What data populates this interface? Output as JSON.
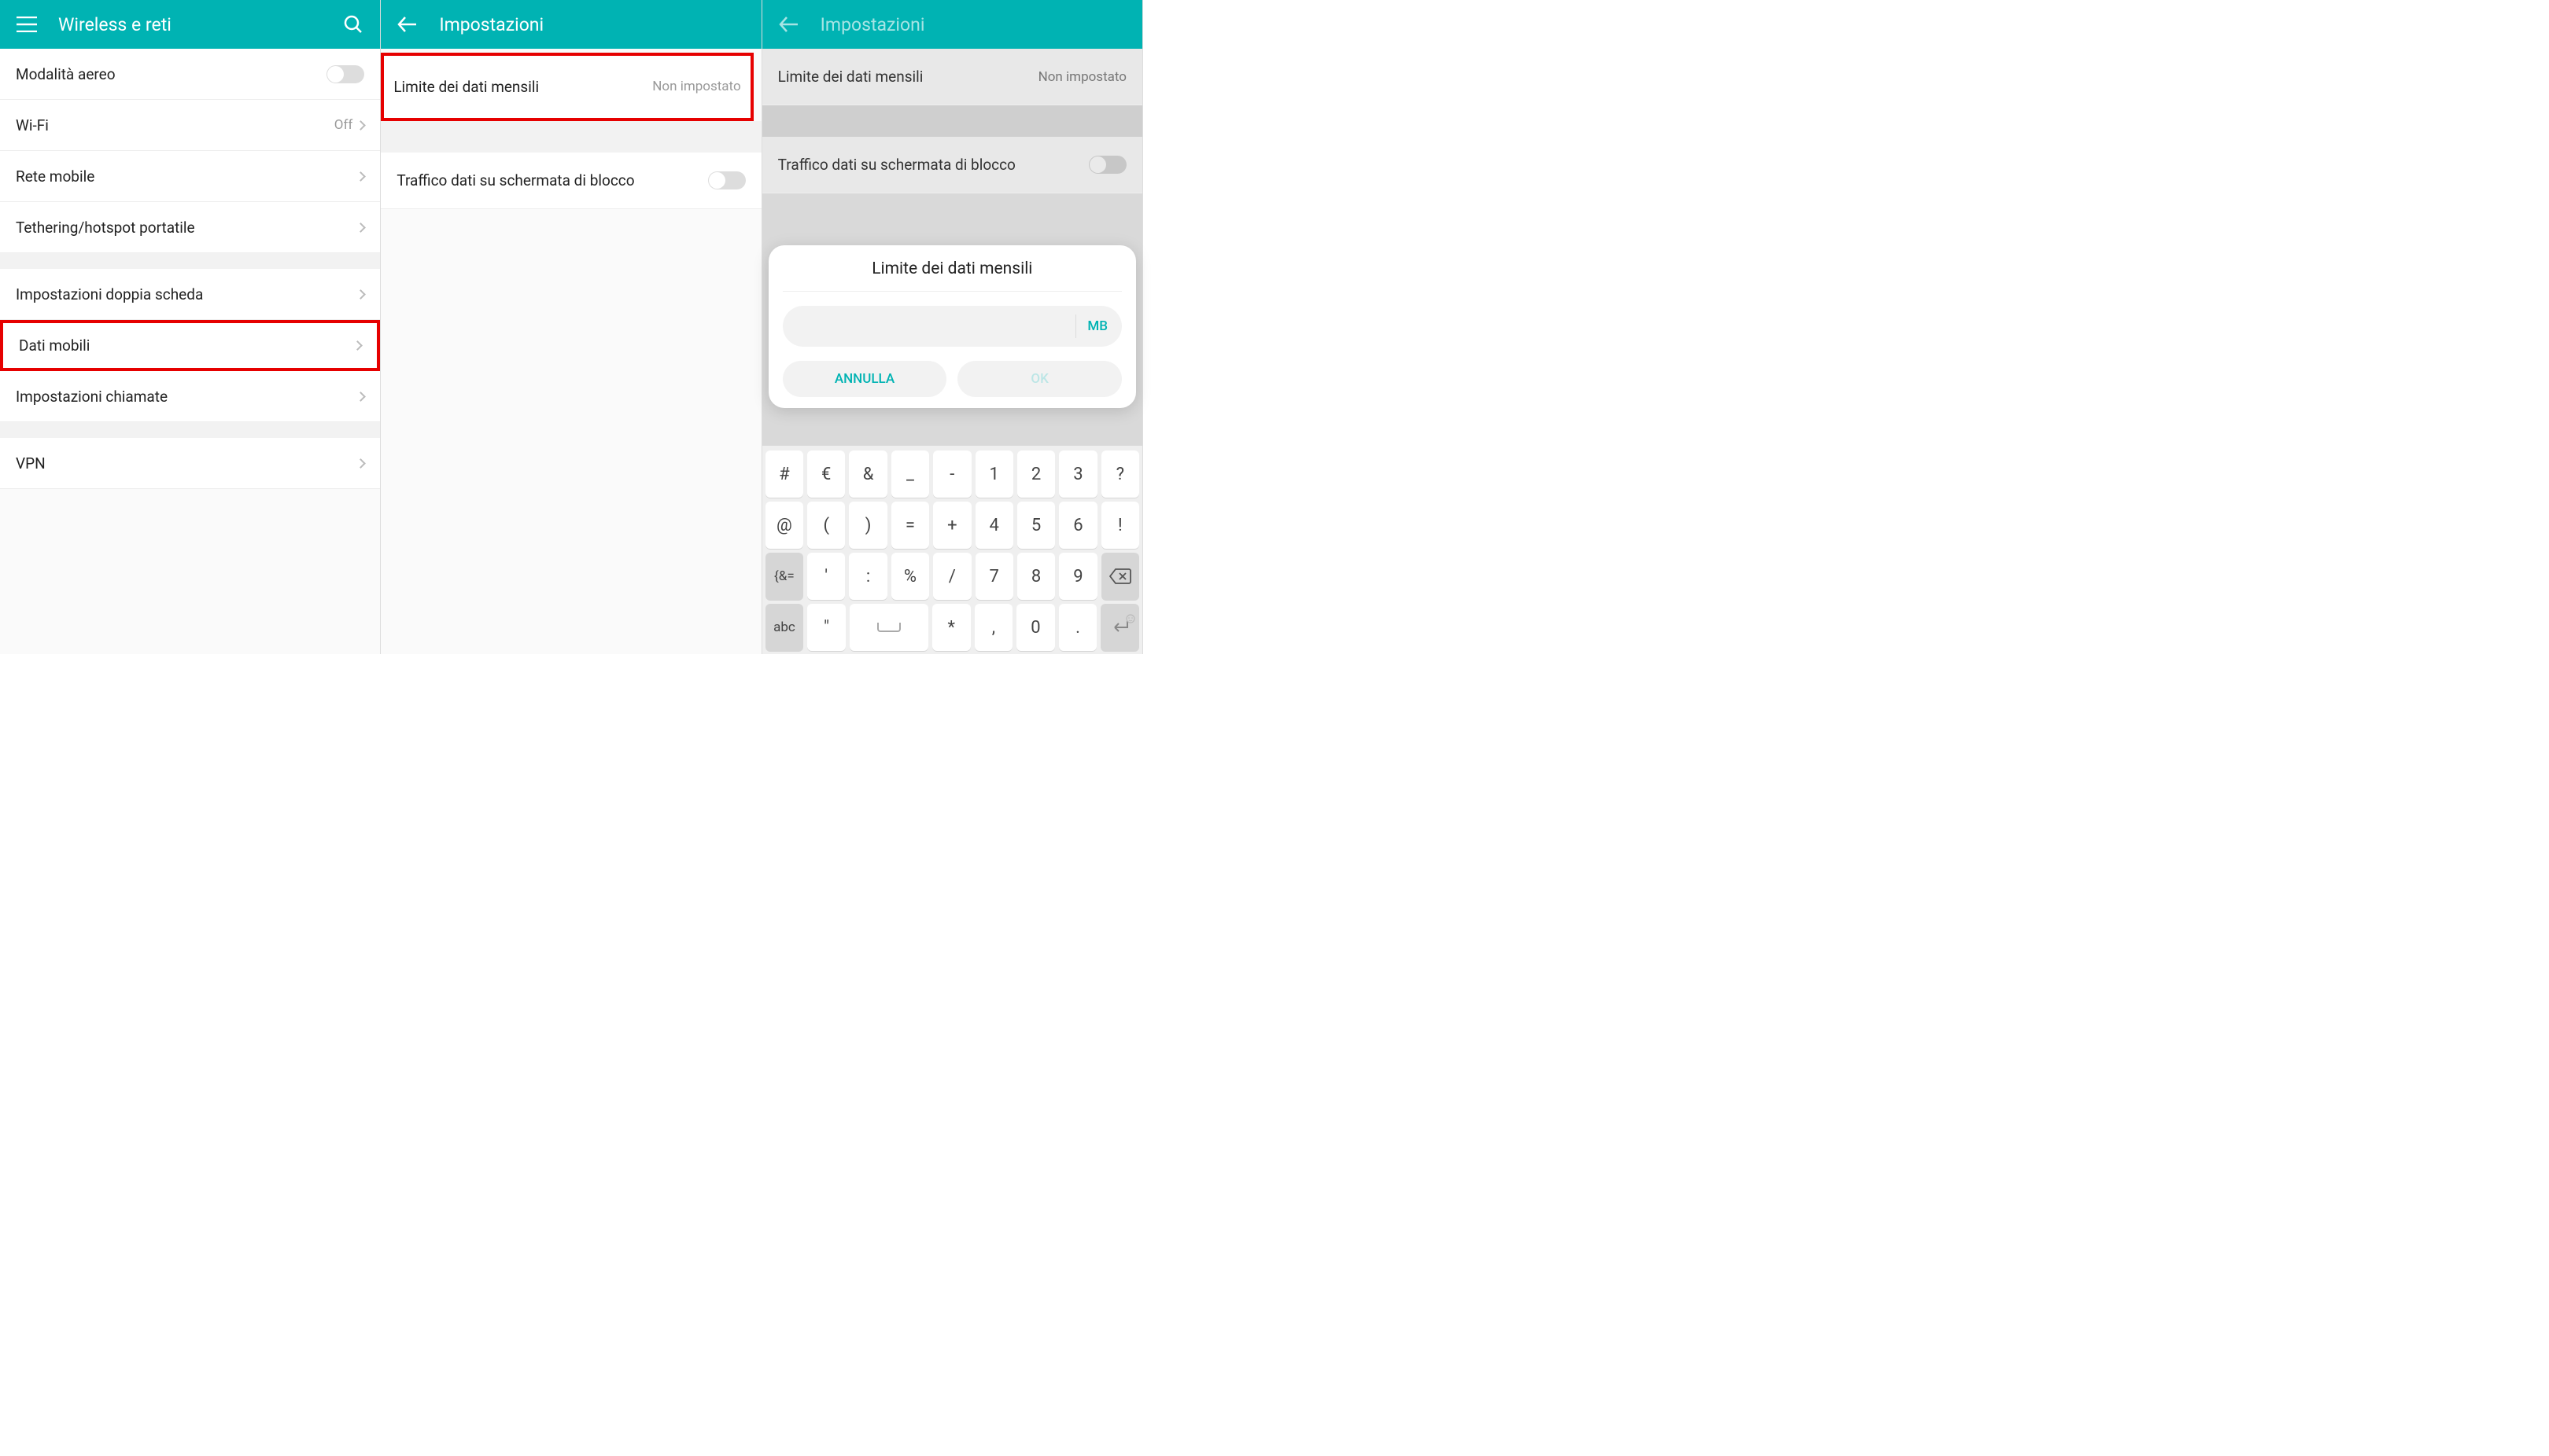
{
  "screen1": {
    "title": "Wireless e reti",
    "items": {
      "airplane": "Modalità aereo",
      "wifi": "Wi-Fi",
      "wifi_value": "Off",
      "mobile_net": "Rete mobile",
      "tethering": "Tethering/hotspot portatile",
      "dual_sim": "Impostazioni doppia scheda",
      "mobile_data": "Dati mobili",
      "call_settings": "Impostazioni chiamate",
      "vpn": "VPN"
    }
  },
  "screen2": {
    "title": "Impostazioni",
    "monthly_limit": "Limite dei dati mensili",
    "monthly_limit_value": "Non impostato",
    "lock_traffic": "Traffico dati su schermata di blocco"
  },
  "screen3": {
    "title": "Impostazioni",
    "monthly_limit": "Limite dei dati mensili",
    "monthly_limit_value": "Non impostato",
    "lock_traffic": "Traffico dati su schermata di blocco",
    "dialog": {
      "title": "Limite dei dati mensili",
      "unit": "MB",
      "cancel": "ANNULLA",
      "ok": "OK"
    },
    "keyboard": {
      "r1": [
        "#",
        "€",
        "&",
        "_",
        "-",
        "1",
        "2",
        "3",
        "?"
      ],
      "r2": [
        "@",
        "(",
        ")",
        "=",
        "+",
        "4",
        "5",
        "6",
        "!"
      ],
      "r3": [
        "{&=",
        "'",
        ":",
        "%",
        "/",
        "7",
        "8",
        "9"
      ],
      "r4": [
        "abc",
        "\"",
        "*",
        ",",
        "0",
        "."
      ]
    }
  }
}
